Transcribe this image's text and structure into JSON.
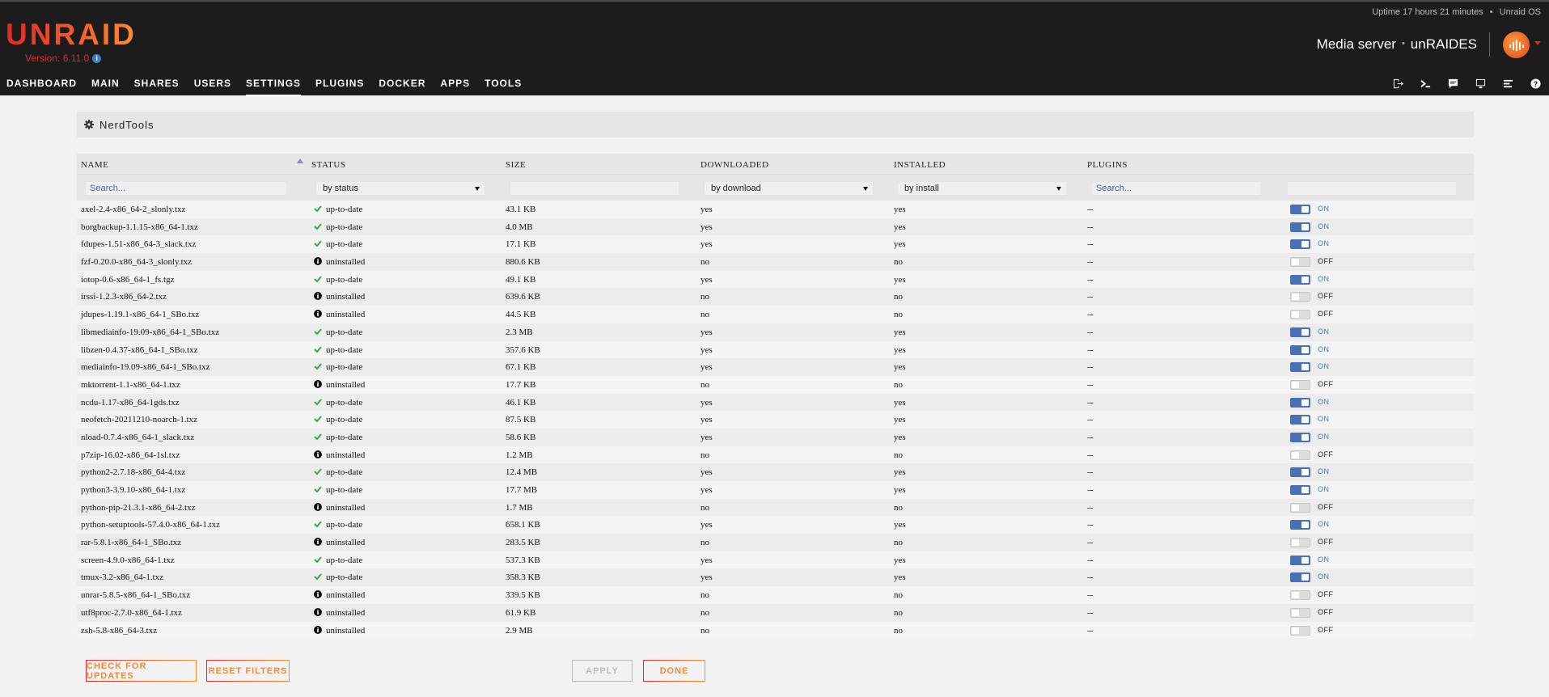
{
  "header": {
    "uptime": "Uptime 17 hours 21 minutes",
    "os_label": "Unraid OS",
    "logo": "UNRAID",
    "version": "Version: 6.11.0",
    "server_description": "Media server",
    "server_name": "unRAIDES"
  },
  "nav": {
    "items": [
      "DASHBOARD",
      "MAIN",
      "SHARES",
      "USERS",
      "SETTINGS",
      "PLUGINS",
      "DOCKER",
      "APPS",
      "TOOLS"
    ],
    "active": "SETTINGS",
    "icons": [
      "logout-icon",
      "terminal-icon",
      "feedback-icon",
      "display-icon",
      "log-icon",
      "help-icon"
    ]
  },
  "panel": {
    "title": "NerdTools",
    "icon": "gear-icon"
  },
  "table": {
    "columns": {
      "name": "NAME",
      "status": "STATUS",
      "size": "SIZE",
      "downloaded": "DOWNLOADED",
      "installed": "INSTALLED",
      "plugins": "PLUGINS"
    },
    "filters": {
      "name_placeholder": "Search...",
      "status_select": "by status",
      "download_select": "by download",
      "install_select": "by install",
      "plugins_placeholder": "Search..."
    },
    "rows": [
      {
        "name": "axel-2.4-x86_64-2_slonly.txz",
        "status": "up-to-date",
        "size": "43.1 KB",
        "downloaded": "yes",
        "installed": "yes",
        "plugins": "--",
        "toggle": "ON"
      },
      {
        "name": "borgbackup-1.1.15-x86_64-1.txz",
        "status": "up-to-date",
        "size": "4.0 MB",
        "downloaded": "yes",
        "installed": "yes",
        "plugins": "--",
        "toggle": "ON"
      },
      {
        "name": "fdupes-1.51-x86_64-3_slack.txz",
        "status": "up-to-date",
        "size": "17.1 KB",
        "downloaded": "yes",
        "installed": "yes",
        "plugins": "--",
        "toggle": "ON"
      },
      {
        "name": "fzf-0.20.0-x86_64-3_slonly.txz",
        "status": "uninstalled",
        "size": "880.6 KB",
        "downloaded": "no",
        "installed": "no",
        "plugins": "--",
        "toggle": "OFF"
      },
      {
        "name": "iotop-0.6-x86_64-1_fs.tgz",
        "status": "up-to-date",
        "size": "49.1 KB",
        "downloaded": "yes",
        "installed": "yes",
        "plugins": "--",
        "toggle": "ON"
      },
      {
        "name": "irssi-1.2.3-x86_64-2.txz",
        "status": "uninstalled",
        "size": "639.6 KB",
        "downloaded": "no",
        "installed": "no",
        "plugins": "--",
        "toggle": "OFF"
      },
      {
        "name": "jdupes-1.19.1-x86_64-1_SBo.txz",
        "status": "uninstalled",
        "size": "44.5 KB",
        "downloaded": "no",
        "installed": "no",
        "plugins": "--",
        "toggle": "OFF"
      },
      {
        "name": "libmediainfo-19.09-x86_64-1_SBo.txz",
        "status": "up-to-date",
        "size": "2.3 MB",
        "downloaded": "yes",
        "installed": "yes",
        "plugins": "--",
        "toggle": "ON"
      },
      {
        "name": "libzen-0.4.37-x86_64-1_SBo.txz",
        "status": "up-to-date",
        "size": "357.6 KB",
        "downloaded": "yes",
        "installed": "yes",
        "plugins": "--",
        "toggle": "ON"
      },
      {
        "name": "mediainfo-19.09-x86_64-1_SBo.txz",
        "status": "up-to-date",
        "size": "67.1 KB",
        "downloaded": "yes",
        "installed": "yes",
        "plugins": "--",
        "toggle": "ON"
      },
      {
        "name": "mktorrent-1.1-x86_64-1.txz",
        "status": "uninstalled",
        "size": "17.7 KB",
        "downloaded": "no",
        "installed": "no",
        "plugins": "--",
        "toggle": "OFF"
      },
      {
        "name": "ncdu-1.17-x86_64-1gds.txz",
        "status": "up-to-date",
        "size": "46.1 KB",
        "downloaded": "yes",
        "installed": "yes",
        "plugins": "--",
        "toggle": "ON"
      },
      {
        "name": "neofetch-20211210-noarch-1.txz",
        "status": "up-to-date",
        "size": "87.5 KB",
        "downloaded": "yes",
        "installed": "yes",
        "plugins": "--",
        "toggle": "ON"
      },
      {
        "name": "nload-0.7.4-x86_64-1_slack.txz",
        "status": "up-to-date",
        "size": "58.6 KB",
        "downloaded": "yes",
        "installed": "yes",
        "plugins": "--",
        "toggle": "ON"
      },
      {
        "name": "p7zip-16.02-x86_64-1sl.txz",
        "status": "uninstalled",
        "size": "1.2 MB",
        "downloaded": "no",
        "installed": "no",
        "plugins": "--",
        "toggle": "OFF"
      },
      {
        "name": "python2-2.7.18-x86_64-4.txz",
        "status": "up-to-date",
        "size": "12.4 MB",
        "downloaded": "yes",
        "installed": "yes",
        "plugins": "--",
        "toggle": "ON"
      },
      {
        "name": "python3-3.9.10-x86_64-1.txz",
        "status": "up-to-date",
        "size": "17.7 MB",
        "downloaded": "yes",
        "installed": "yes",
        "plugins": "--",
        "toggle": "ON"
      },
      {
        "name": "python-pip-21.3.1-x86_64-2.txz",
        "status": "uninstalled",
        "size": "1.7 MB",
        "downloaded": "no",
        "installed": "no",
        "plugins": "--",
        "toggle": "OFF"
      },
      {
        "name": "python-setuptools-57.4.0-x86_64-1.txz",
        "status": "up-to-date",
        "size": "658.1 KB",
        "downloaded": "yes",
        "installed": "yes",
        "plugins": "--",
        "toggle": "ON"
      },
      {
        "name": "rar-5.8.1-x86_64-1_SBo.txz",
        "status": "uninstalled",
        "size": "283.5 KB",
        "downloaded": "no",
        "installed": "no",
        "plugins": "--",
        "toggle": "OFF"
      },
      {
        "name": "screen-4.9.0-x86_64-1.txz",
        "status": "up-to-date",
        "size": "537.3 KB",
        "downloaded": "yes",
        "installed": "yes",
        "plugins": "--",
        "toggle": "ON"
      },
      {
        "name": "tmux-3.2-x86_64-1.txz",
        "status": "up-to-date",
        "size": "358.3 KB",
        "downloaded": "yes",
        "installed": "yes",
        "plugins": "--",
        "toggle": "ON"
      },
      {
        "name": "unrar-5.8.5-x86_64-1_SBo.txz",
        "status": "uninstalled",
        "size": "339.5 KB",
        "downloaded": "no",
        "installed": "no",
        "plugins": "--",
        "toggle": "OFF"
      },
      {
        "name": "utf8proc-2.7.0-x86_64-1.txz",
        "status": "uninstalled",
        "size": "61.9 KB",
        "downloaded": "no",
        "installed": "no",
        "plugins": "--",
        "toggle": "OFF"
      },
      {
        "name": "zsh-5.8-x86_64-3.txz",
        "status": "uninstalled",
        "size": "2.9 MB",
        "downloaded": "no",
        "installed": "no",
        "plugins": "--",
        "toggle": "OFF"
      }
    ]
  },
  "buttons": {
    "check_updates": "CHECK FOR UPDATES",
    "reset_filters": "RESET FILTERS",
    "apply": "APPLY",
    "done": "DONE"
  },
  "colors": {
    "header_bg": "#1c1c1c",
    "brand_start": "#e22828",
    "brand_end": "#ff8c2f",
    "toggle_on": "#4a6fb8",
    "status_ok": "#3aa845"
  }
}
